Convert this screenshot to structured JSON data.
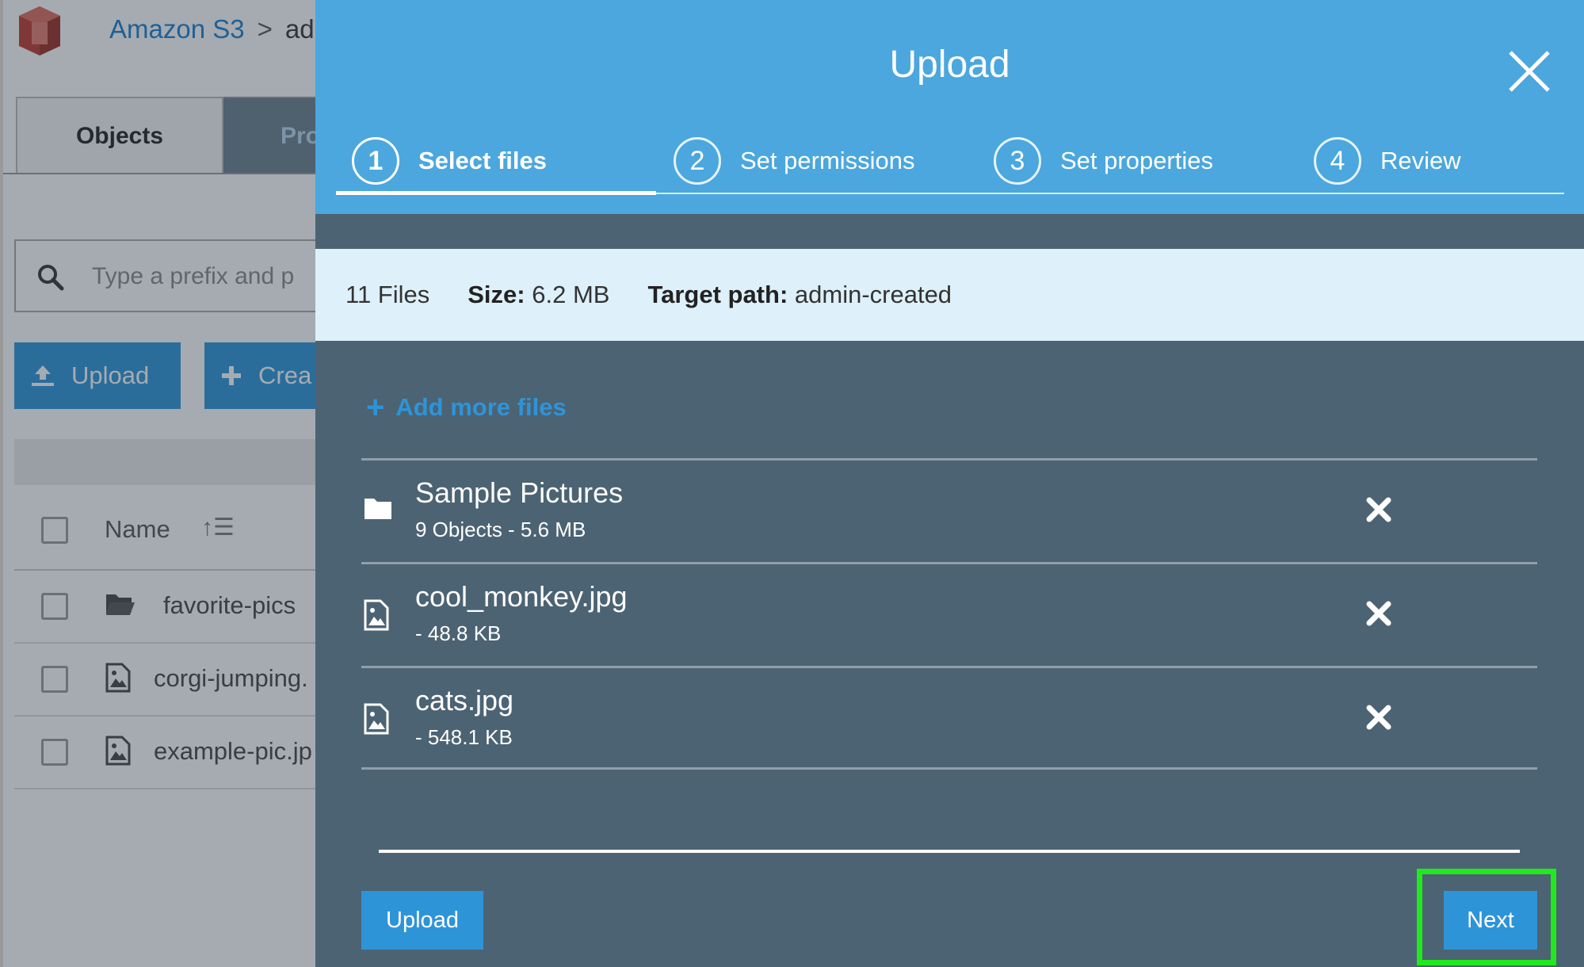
{
  "background": {
    "breadcrumb": {
      "root": "Amazon S3",
      "separator": ">",
      "current": "ad"
    },
    "tabs": [
      {
        "label": "Objects"
      },
      {
        "label": "Pro"
      }
    ],
    "search": {
      "placeholder": "Type a prefix and p"
    },
    "buttons": {
      "upload": "Upload",
      "create": "Crea"
    },
    "table": {
      "name_header": "Name",
      "sort_glyph": "↑☰",
      "rows": [
        {
          "name": "favorite-pics",
          "icon": "folder-open-icon"
        },
        {
          "name": "corgi-jumping.",
          "icon": "image-file-icon"
        },
        {
          "name": "example-pic.jp",
          "icon": "image-file-icon"
        }
      ]
    }
  },
  "modal": {
    "title": "Upload",
    "steps": [
      {
        "number": "1",
        "label": "Select files",
        "active": true
      },
      {
        "number": "2",
        "label": "Set permissions",
        "active": false
      },
      {
        "number": "3",
        "label": "Set properties",
        "active": false
      },
      {
        "number": "4",
        "label": "Review",
        "active": false
      }
    ],
    "summary": {
      "files": "11 Files",
      "size_label": "Size:",
      "size_value": "6.2 MB",
      "target_label": "Target path:",
      "target_value": "admin-created"
    },
    "add_more_label": "Add more files",
    "files": [
      {
        "name": "Sample Pictures",
        "meta": "9 Objects - 5.6 MB",
        "icon": "folder-icon"
      },
      {
        "name": "cool_monkey.jpg",
        "meta": "- 48.8 KB",
        "icon": "image-file-icon"
      },
      {
        "name": "cats.jpg",
        "meta": "- 548.1 KB",
        "icon": "image-file-icon"
      }
    ],
    "upload_button": "Upload",
    "next_button": "Next"
  },
  "colors": {
    "header": "#4ba7de",
    "body": "#4c6373",
    "accent": "#2e94d8",
    "highlight": "#22e81e"
  }
}
